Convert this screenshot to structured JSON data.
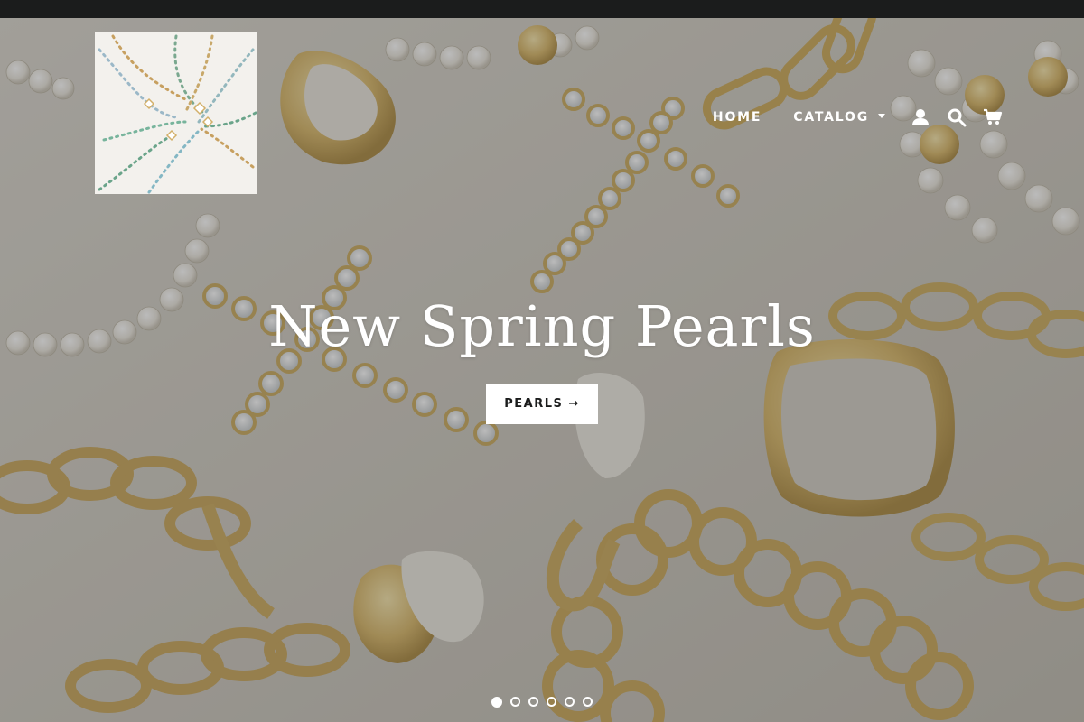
{
  "header": {
    "logo_alt": "Jewelry store logo",
    "nav": [
      {
        "label": "HOME"
      },
      {
        "label": "CATALOG"
      }
    ],
    "icons": [
      "account-icon",
      "search-icon",
      "cart-icon"
    ]
  },
  "hero": {
    "title": "New Spring Pearls",
    "button_label": "PEARLS",
    "button_arrow": "→",
    "slides_total": 6,
    "active_slide": 1
  },
  "colors": {
    "announcement_bar": "#1b1c1c",
    "button_bg": "#ffffff",
    "button_text": "#1b1c1c",
    "nav_text": "#ffffff"
  }
}
